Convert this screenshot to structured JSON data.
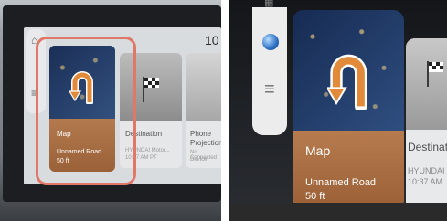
{
  "left": {
    "clock_partial": "10",
    "cards": {
      "map": {
        "title": "Map",
        "line1": "Unnamed Road",
        "line2": "50 ft"
      },
      "destination": {
        "title": "Destination",
        "line1": "HYUNDAI Motor...",
        "line2": "10:37 AM PT"
      },
      "phone": {
        "title": "Phone",
        "title2": "Projection",
        "line1": "No Connected",
        "line2": "Device"
      }
    }
  },
  "right": {
    "cards": {
      "map": {
        "title": "Map",
        "line1": "Unnamed Road",
        "line2": "50 ft"
      },
      "destination": {
        "title": "Destinati",
        "line1": "HYUNDAI",
        "line2": "10:37 AM"
      }
    }
  },
  "colors": {
    "highlight": "#e0786a",
    "map_card_blue": "#25467c",
    "map_card_copper": "#b67b4e",
    "uturn_arrow": "#e08a3a"
  },
  "icons": [
    "home-icon",
    "globe-icon",
    "menu-icon",
    "u-turn-icon",
    "checkered-flag-icon",
    "phone-icon"
  ]
}
